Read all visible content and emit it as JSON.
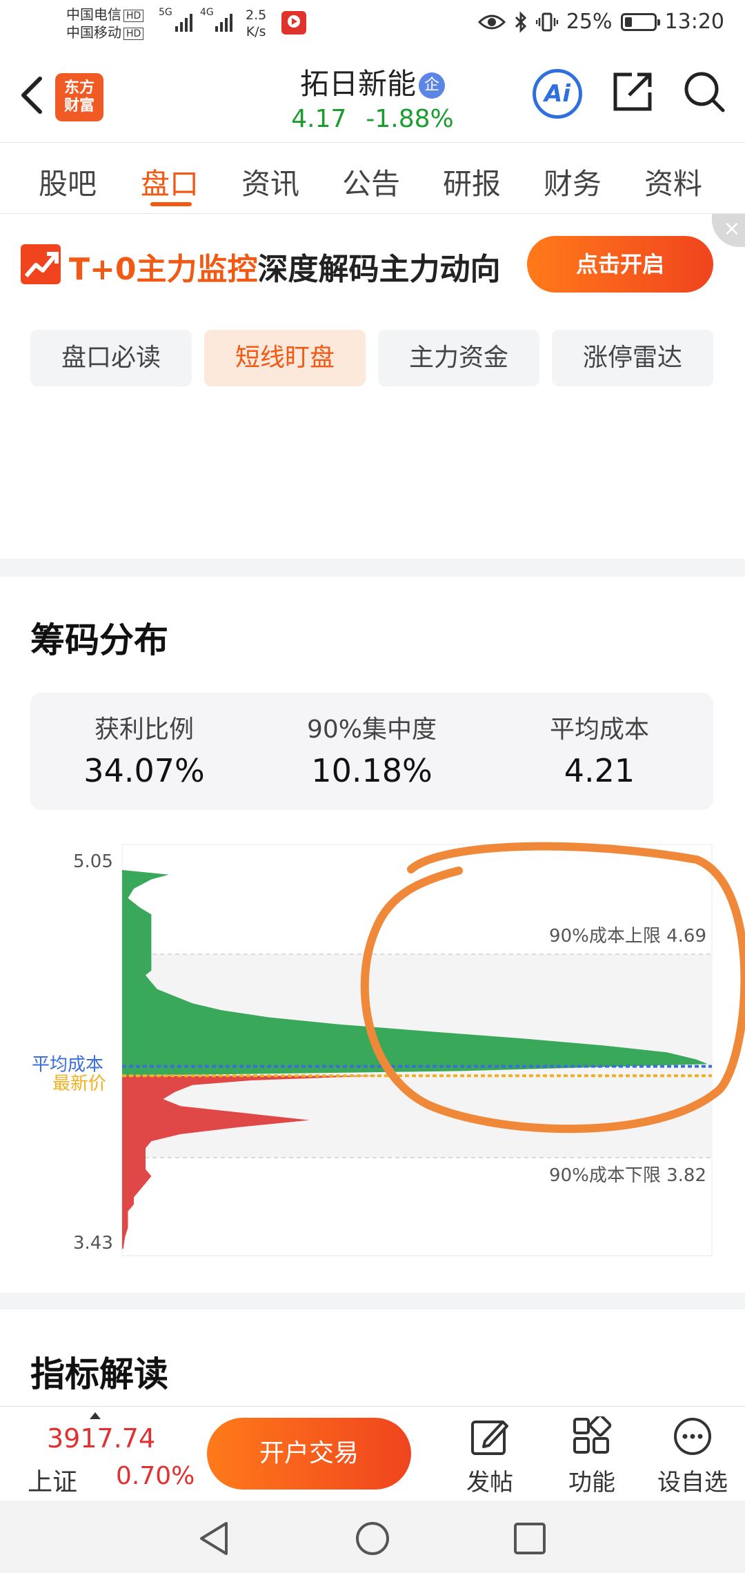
{
  "status_bar": {
    "carrier_1": "中国电信",
    "carrier_2": "中国移动",
    "hd": "HD",
    "net_1": "5G",
    "net_2": "4G",
    "speed_value": "2.5",
    "speed_unit": "K/s",
    "battery_percent": "25%",
    "time": "13:20"
  },
  "header": {
    "logo_line1": "东方",
    "logo_line2": "财富",
    "stock_name": "拓日新能",
    "badge": "企",
    "price": "4.17",
    "change_pct": "-1.88%",
    "ai_label": "Ai",
    "price_color": "#1a9d2e"
  },
  "tabs": [
    {
      "label": "股吧"
    },
    {
      "label": "盘口"
    },
    {
      "label": "资讯"
    },
    {
      "label": "公告"
    },
    {
      "label": "研报"
    },
    {
      "label": "财务"
    },
    {
      "label": "资料"
    }
  ],
  "active_tab": "盘口",
  "banner": {
    "highlight": "T+0主力监控",
    "text": "深度解码主力动向",
    "button": "点击开启",
    "close": "×"
  },
  "chips": [
    {
      "label": "盘口必读"
    },
    {
      "label": "短线盯盘"
    },
    {
      "label": "主力资金"
    },
    {
      "label": "涨停雷达"
    }
  ],
  "active_chip": "短线盯盘",
  "chip_distribution": {
    "title": "筹码分布",
    "stats": [
      {
        "label": "获利比例",
        "value": "34.07%"
      },
      {
        "label": "90%集中度",
        "value": "10.18%"
      },
      {
        "label": "平均成本",
        "value": "4.21"
      }
    ]
  },
  "chart_data": {
    "type": "bar",
    "orientation": "horizontal",
    "y_axis_top_label": "5.05",
    "y_axis_bottom_label": "3.43",
    "ylim": [
      3.43,
      5.05
    ],
    "annotations": {
      "upper_90_label": "90%成本上限 4.69",
      "upper_90_value": 4.69,
      "lower_90_label": "90%成本下限 3.82",
      "lower_90_value": 3.82,
      "avg_cost_label": "平均成本",
      "avg_cost_value": 4.21,
      "latest_price_label": "最新价",
      "latest_price_value": 4.17
    },
    "colors": {
      "profit": "#3aa85b",
      "loss": "#e04848",
      "avg_line": "#3a6fd8",
      "latest_line": "#f0b020",
      "band": "#f4f4f4"
    },
    "series": [
      {
        "name": "",
        "color": "#3aa85b",
        "points": [
          [
            5.05,
            0.0
          ],
          [
            5.03,
            0.08
          ],
          [
            5.01,
            0.05
          ],
          [
            4.97,
            0.02
          ],
          [
            4.93,
            0.01
          ],
          [
            4.89,
            0.03
          ],
          [
            4.86,
            0.05
          ],
          [
            4.82,
            0.05
          ],
          [
            4.78,
            0.05
          ],
          [
            4.74,
            0.05
          ],
          [
            4.7,
            0.05
          ],
          [
            4.66,
            0.05
          ],
          [
            4.62,
            0.05
          ],
          [
            4.6,
            0.04
          ],
          [
            4.57,
            0.05
          ],
          [
            4.54,
            0.06
          ],
          [
            4.51,
            0.09
          ],
          [
            4.48,
            0.12
          ],
          [
            4.45,
            0.17
          ],
          [
            4.42,
            0.25
          ],
          [
            4.39,
            0.37
          ],
          [
            4.36,
            0.52
          ],
          [
            4.33,
            0.68
          ],
          [
            4.3,
            0.82
          ],
          [
            4.27,
            0.93
          ],
          [
            4.24,
            0.98
          ],
          [
            4.22,
            1.0
          ],
          [
            4.19,
            0.58
          ],
          [
            4.17,
            0.0
          ]
        ]
      },
      {
        "name": "",
        "color": "#e04848",
        "points": [
          [
            4.17,
            0.44
          ],
          [
            4.15,
            0.22
          ],
          [
            4.13,
            0.12
          ],
          [
            4.1,
            0.09
          ],
          [
            4.07,
            0.07
          ],
          [
            4.04,
            0.1
          ],
          [
            4.01,
            0.21
          ],
          [
            3.98,
            0.32
          ],
          [
            3.95,
            0.2
          ],
          [
            3.92,
            0.1
          ],
          [
            3.89,
            0.05
          ],
          [
            3.86,
            0.04
          ],
          [
            3.83,
            0.04
          ],
          [
            3.8,
            0.04
          ],
          [
            3.77,
            0.04
          ],
          [
            3.74,
            0.05
          ],
          [
            3.71,
            0.04
          ],
          [
            3.68,
            0.03
          ],
          [
            3.65,
            0.02
          ],
          [
            3.62,
            0.02
          ],
          [
            3.59,
            0.01
          ],
          [
            3.56,
            0.01
          ],
          [
            3.52,
            0.01
          ],
          [
            3.48,
            0.005
          ],
          [
            3.43,
            0.002
          ]
        ]
      }
    ]
  },
  "indicator": {
    "title": "指标解读"
  },
  "bottom_bar": {
    "index_value": "3917.74",
    "index_name": "上证",
    "index_pct": "0.70%",
    "open_account": "开户交易",
    "post": "发帖",
    "functions": "功能",
    "watchlist": "设自选"
  }
}
